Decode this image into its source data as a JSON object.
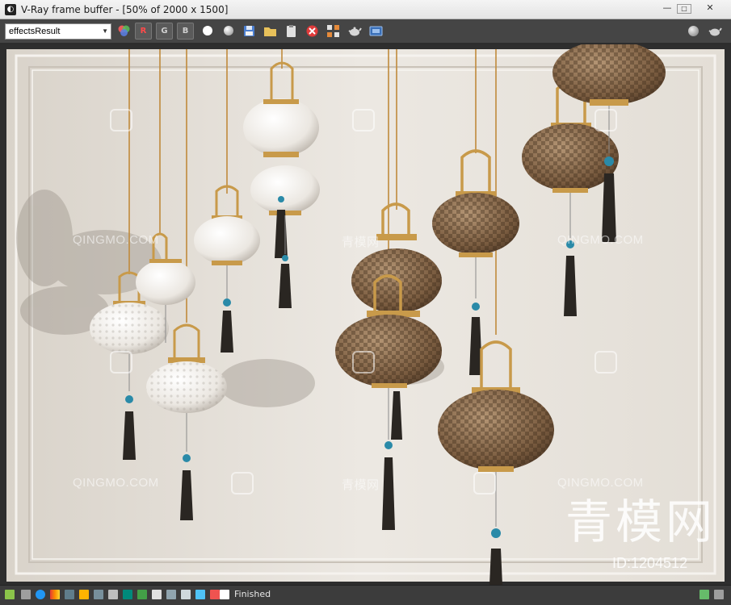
{
  "window": {
    "title": "V-Ray frame buffer - [50% of 2000 x 1500]",
    "minimize_glyph": "—",
    "maximize_glyph": "□",
    "close_glyph": "✕"
  },
  "toolbar": {
    "channel_value": "effectsResult",
    "red_label": "R",
    "green_label": "G",
    "blue_label": "B",
    "icons": [
      "color-mode-icon",
      "red-channel",
      "green-channel",
      "blue-channel",
      "white-dot-icon",
      "grey-dot-icon",
      "save-icon",
      "folder-icon",
      "clipboard-icon",
      "clear-icon",
      "region-render-icon",
      "teapot-icon",
      "render-settings-icon",
      "sphere-icon",
      "teapot-right-icon"
    ]
  },
  "status": {
    "text": "Finished"
  },
  "watermarks": {
    "text_en": "QINGMO.COM",
    "text_cn": "青模网",
    "big": "青模网",
    "id": "ID:1204512"
  },
  "colors": {
    "accent_red": "#ff4a4a",
    "toolbar_bg": "#454545",
    "brass": "#c89a4a",
    "wall": "#e6e1da"
  }
}
